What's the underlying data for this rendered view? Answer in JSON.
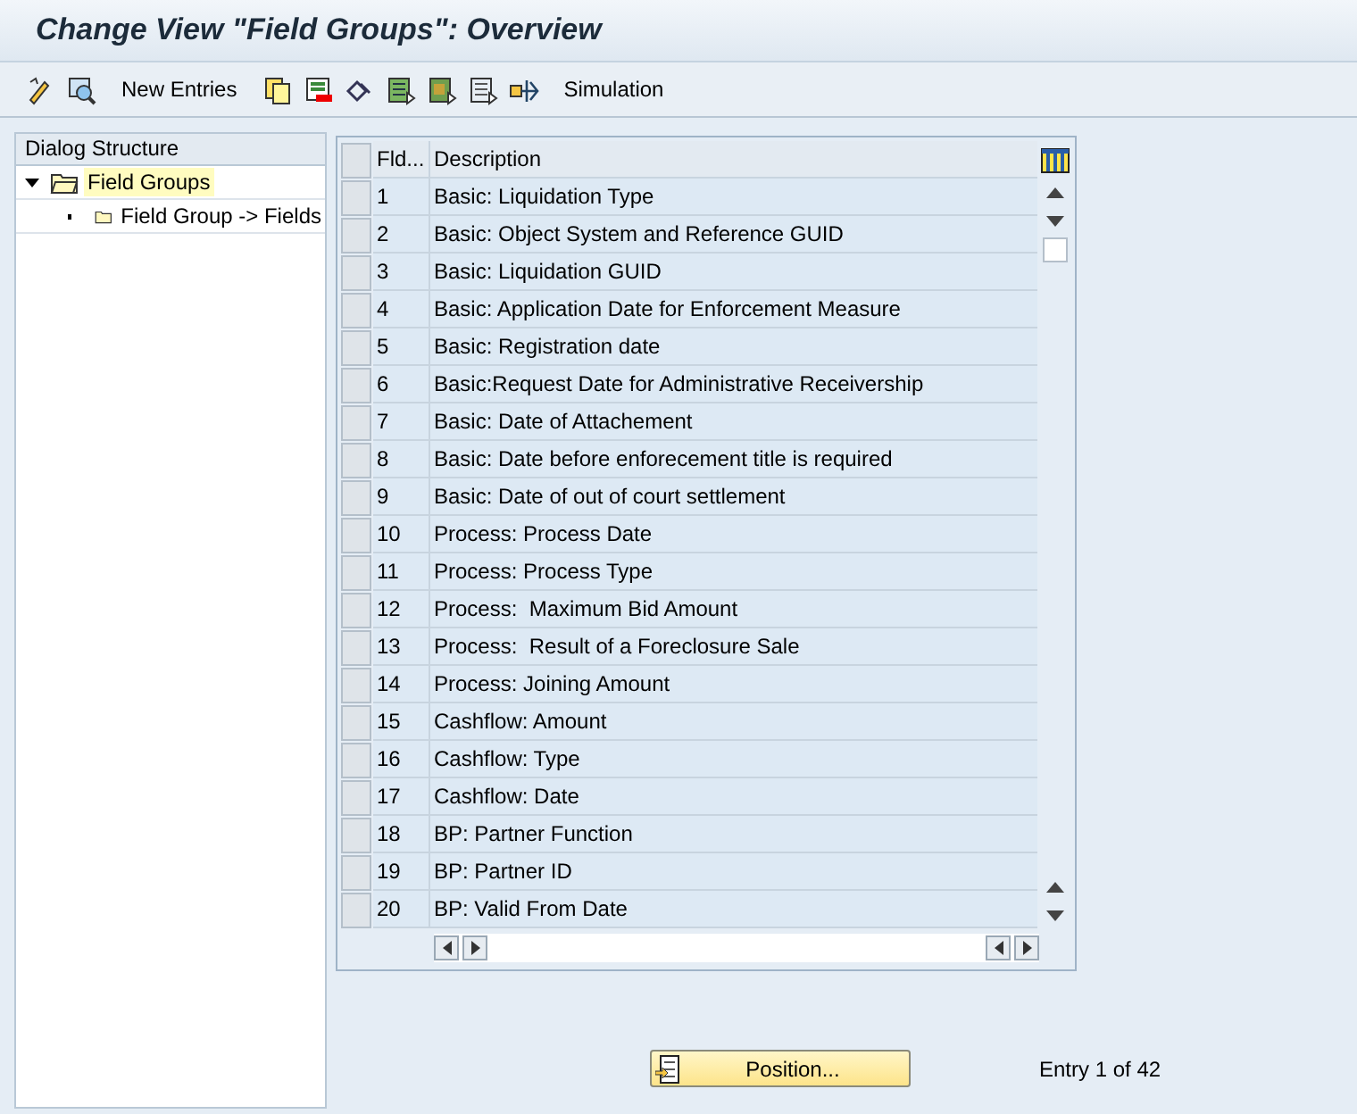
{
  "window": {
    "title": "Change View \"Field Groups\": Overview"
  },
  "toolbar": {
    "new_entries": "New Entries",
    "simulation": "Simulation"
  },
  "dialog_structure": {
    "title": "Dialog Structure",
    "items": [
      {
        "label": "Field Groups",
        "expanded": true,
        "selected": true,
        "children": [
          {
            "label": "Field Group -> Fields",
            "selected": false
          }
        ]
      }
    ]
  },
  "table": {
    "columns": [
      "Fld...",
      "Description"
    ],
    "rows": [
      {
        "number": "1",
        "description": "Basic: Liquidation Type"
      },
      {
        "number": "2",
        "description": "Basic: Object System and Reference GUID"
      },
      {
        "number": "3",
        "description": "Basic: Liquidation GUID"
      },
      {
        "number": "4",
        "description": "Basic: Application Date for Enforcement Measure"
      },
      {
        "number": "5",
        "description": "Basic: Registration date"
      },
      {
        "number": "6",
        "description": "Basic:Request Date for Administrative Receivership"
      },
      {
        "number": "7",
        "description": "Basic: Date of Attachement"
      },
      {
        "number": "8",
        "description": "Basic: Date before enforecement title is required"
      },
      {
        "number": "9",
        "description": "Basic: Date of out of court settlement"
      },
      {
        "number": "10",
        "description": "Process: Process Date"
      },
      {
        "number": "11",
        "description": "Process: Process Type"
      },
      {
        "number": "12",
        "description": "Process:  Maximum Bid Amount"
      },
      {
        "number": "13",
        "description": "Process:  Result of a Foreclosure Sale"
      },
      {
        "number": "14",
        "description": "Process: Joining Amount"
      },
      {
        "number": "15",
        "description": "Cashflow: Amount"
      },
      {
        "number": "16",
        "description": "Cashflow: Type"
      },
      {
        "number": "17",
        "description": "Cashflow: Date"
      },
      {
        "number": "18",
        "description": "BP: Partner Function"
      },
      {
        "number": "19",
        "description": "BP: Partner ID"
      },
      {
        "number": "20",
        "description": "BP: Valid From Date"
      }
    ]
  },
  "position_button": "Position...",
  "entry_info": "Entry 1 of 42"
}
